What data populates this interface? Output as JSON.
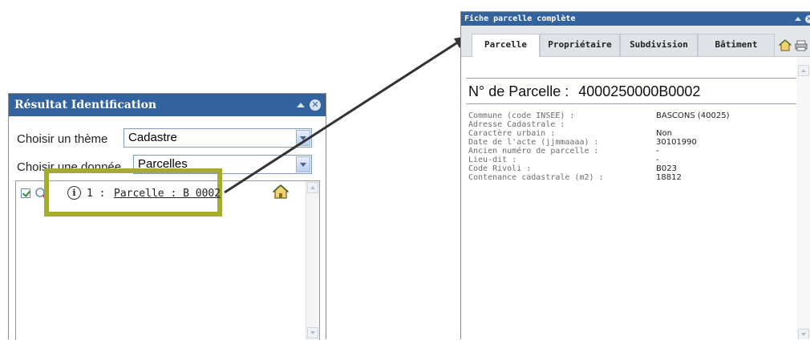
{
  "left_panel": {
    "title": "Résultat Identification",
    "theme_label": "Choisir un thème",
    "theme_value": "Cadastre",
    "data_label": "Choisir une donnée",
    "data_value": "Parcelles",
    "result_index": "1 :",
    "result_link": "Parcelle : B 0002"
  },
  "right_panel": {
    "title": "Fiche parcelle complète",
    "tabs": [
      "Parcelle",
      "Propriétaire",
      "Subdivision",
      "Bâtiment"
    ],
    "active_tab": "Parcelle",
    "parcel_heading_label": "N° de Parcelle :",
    "parcel_number": "4000250000B0002",
    "fields": [
      {
        "label": "Commune (code INSEE) :",
        "value": "BASCONS (40025)"
      },
      {
        "label": "Adresse Cadastrale :",
        "value": ""
      },
      {
        "label": "Caractère urbain :",
        "value": "Non"
      },
      {
        "label": "Date de l'acte (jjmmaaaa) :",
        "value": "30101990"
      },
      {
        "label": "Ancien numéro de parcelle :",
        "value": "-"
      },
      {
        "label": "Lieu-dit :",
        "value": "-"
      },
      {
        "label": "Code Rivoli :",
        "value": "B023"
      },
      {
        "label": "Contenance cadastrale (m2) :",
        "value": "18812"
      }
    ]
  },
  "colors": {
    "title_bar": "#33639f",
    "highlight_border": "#a5ab2f",
    "arrow": "#333333"
  },
  "icons": [
    "collapse-icon",
    "close-icon",
    "info-icon",
    "home-icon",
    "print-icon",
    "checkbox-icon",
    "magnifier-icon"
  ]
}
